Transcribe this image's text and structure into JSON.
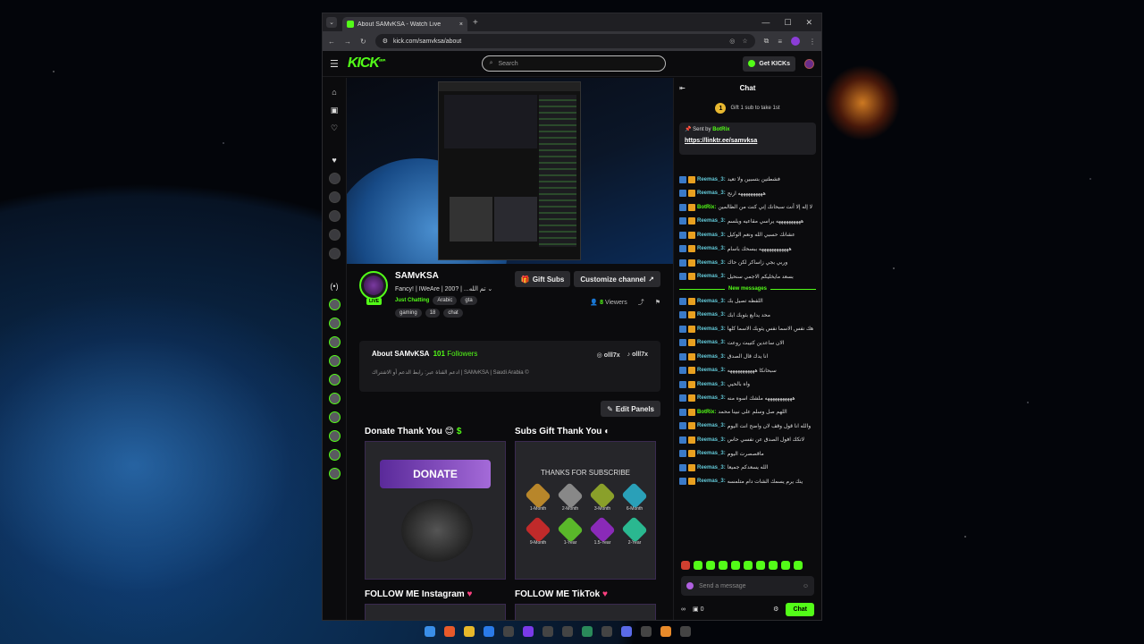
{
  "browser": {
    "tab_title": "About SAMvKSA - Watch Live",
    "url": "kick.com/samvksa/about"
  },
  "header": {
    "logo": "KICK",
    "logo_sup": "BETA",
    "search_placeholder": "Search",
    "get_kicks_label": "Get KICKs"
  },
  "channel": {
    "name": "SAMvKSA",
    "title": "Fancy! | IWeAre | 200? | ...تم الله",
    "live_badge": "LIVE",
    "category": "Just Chatting",
    "tags": [
      "Arabic",
      "gta",
      "gaming",
      "18",
      "chat"
    ],
    "gift_subs_label": "Gift Subs",
    "customize_label": "Customize channel",
    "viewers_count": "8",
    "viewers_label": "Viewers"
  },
  "about": {
    "title": "About SAMvKSA",
    "followers_count": "101",
    "followers_label": "Followers",
    "description": "ادعم القناة عبر: رابط الدعم أو الاشتراك | SAMvKSA | Saudi Arabia ©",
    "instagram": "olll7x",
    "tiktok": "olll7x",
    "edit_panels_label": "Edit Panels"
  },
  "panels": {
    "donate_title": "Donate Thank You",
    "donate_box": "DONATE",
    "subs_title": "Subs Gift Thank You",
    "subs_heading": "THANKS FOR SUBSCRIBE",
    "badges": [
      {
        "label": "1-Month",
        "color": "#b8862a"
      },
      {
        "label": "2-Month",
        "color": "#888888"
      },
      {
        "label": "3-Month",
        "color": "#8aa02a"
      },
      {
        "label": "6-Month",
        "color": "#2aa0b8"
      },
      {
        "label": "9-Month",
        "color": "#c02a2a"
      },
      {
        "label": "1-Year",
        "color": "#5ab82a"
      },
      {
        "label": "1.5-Year",
        "color": "#8a2ab8"
      },
      {
        "label": "2-Year",
        "color": "#2ab890"
      }
    ],
    "follow_ig_title": "FOLLOW ME Instagram",
    "follow_tt_title": "FOLLOW ME TikTok"
  },
  "chat": {
    "title": "Chat",
    "gift_prompt": "Gift 1 sub to take 1st",
    "pinned_sent_by": "Sent by",
    "pinned_bot": "BotRix",
    "pinned_link": "https://linktr.ee/samvksa",
    "new_messages_label": "New messages",
    "messages": [
      {
        "user": "Reemas_3:",
        "text": "فشطتين بتسبين ولا تعيد"
      },
      {
        "user": "Reemas_3:",
        "text": "ههههههههههه ارنح"
      },
      {
        "user": "BotRix:",
        "text": "لا إله إلا أنت سبحانك إني كنت من الظالمين",
        "bot": true
      },
      {
        "user": "Reemas_3:",
        "text": "ههههههههههه يراسي مقاعيه ويلسم"
      },
      {
        "user": "Reemas_3:",
        "text": "عشانك حسبي الله ونعم الوكيل"
      },
      {
        "user": "Reemas_3:",
        "text": "ههههههههههههه ببسحك باسام"
      },
      {
        "user": "Reemas_3:",
        "text": "وربي بجي زاساكر لكن حاك"
      },
      {
        "user": "Reemas_3:",
        "text": "بسعد مايخليكم الاجمي سنحيل"
      },
      {
        "user": "Reemas_3:",
        "text": "اللفظه تصيل بك",
        "new": true
      },
      {
        "user": "Reemas_3:",
        "text": "محد يدابع بثوبك ابك"
      },
      {
        "user": "Reemas_3:",
        "text": "هك نفس الاسما نفس يثوبك الاسما كلها"
      },
      {
        "user": "Reemas_3:",
        "text": "الان ساعدين كتيبت روعت"
      },
      {
        "user": "Reemas_3:",
        "text": "انا يدك قال الصدق"
      },
      {
        "user": "Reemas_3:",
        "text": "سبحانكا هههههههههههه"
      },
      {
        "user": "Reemas_3:",
        "text": "واه بالحيي"
      },
      {
        "user": "Reemas_3:",
        "text": "هههههههههههه ملشك اسوه منه"
      },
      {
        "user": "BotRix:",
        "text": "اللهم صل وسلم على نبينا محمد",
        "bot": true
      },
      {
        "user": "Reemas_3:",
        "text": "والله انا قول وقف لان واضح انت اليوم"
      },
      {
        "user": "Reemas_3:",
        "text": "لاتكك افول الصدق عن نفسي حاس"
      },
      {
        "user": "Reemas_3:",
        "text": "ماقصصرت اليوم"
      },
      {
        "user": "Reemas_3:",
        "text": "الله يسعدكم جميعا"
      },
      {
        "user": "Reemas_3:",
        "text": "ينك يرم يسمك الشات دام متلمسه"
      }
    ],
    "input_placeholder": "Send a message",
    "points": "0",
    "send_label": "Chat"
  }
}
